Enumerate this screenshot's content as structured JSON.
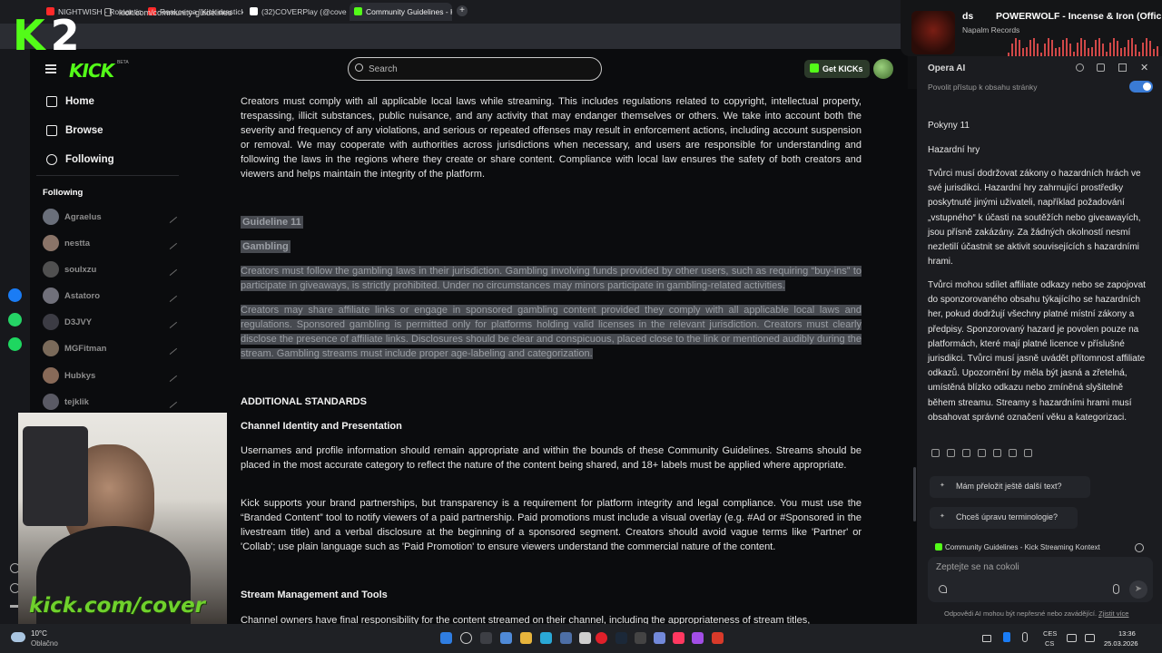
{
  "browser": {
    "tabs": [
      {
        "label": "NIGHTWISH - Romanticid",
        "favicon_color": "#ff2a2a"
      },
      {
        "label": "Reakce na \"Kick drasticky",
        "favicon_color": "#ff2a2a"
      },
      {
        "label": "(32)COVERPlay (@coverpl",
        "favicon_color": "#ffffff"
      },
      {
        "label": "Community Guidelines - K",
        "favicon_color": "#53fc18"
      }
    ],
    "new_tab": "+",
    "url": "kick.com/community-guidelines"
  },
  "kick": {
    "logo": "KICK",
    "beta": "BETA",
    "search_placeholder": "Search",
    "get_kicks": "Get KICKs",
    "nav": [
      {
        "label": "Home",
        "icon": "home-icon"
      },
      {
        "label": "Browse",
        "icon": "browse-icon"
      },
      {
        "label": "Following",
        "icon": "heart-icon"
      }
    ],
    "following_title": "Following",
    "following": [
      "Agraelus",
      "nestta",
      "soulxzu",
      "Astatoro",
      "D3JVY",
      "MGFitman",
      "Hubkys",
      "tejklik"
    ],
    "accent": "#53fc18"
  },
  "article": {
    "intro": "Creators must comply with all applicable local laws while streaming. This includes regulations related to copyright, intellectual property, trespassing, illicit substances, public nuisance, and any activity that may endanger themselves or others. We take into account both the severity and frequency of any violations, and serious or repeated offenses may result in enforcement actions, including account suspension or removal. We may cooperate with authorities across jurisdictions when necessary, and users are responsible for understanding and following the laws in the regions where they create or share content. Compliance with local law ensures the safety of both creators and viewers and helps maintain the integrity of the platform.",
    "g11_label": "Guideline 11",
    "g11_title": "Gambling",
    "g11_p1": "Creators must follow the gambling laws in their jurisdiction. Gambling involving funds provided by other users, such as requiring “buy-ins” to participate in giveaways, is strictly prohibited. Under no circumstances may minors participate in gambling-related activities.",
    "g11_p2": "Creators may share affiliate links or engage in sponsored gambling content provided they comply with all applicable local laws and regulations. Sponsored gambling is permitted only for platforms holding valid licenses in the relevant jurisdiction. Creators must clearly disclose the presence of affiliate links. Disclosures should be clear and conspicuous, placed close to the link or mentioned audibly during the stream. Gambling streams must include proper age-labeling and categorization.",
    "additional": "ADDITIONAL STANDARDS",
    "channel_title": "Channel Identity and Presentation",
    "channel_p1": "Usernames and profile information should remain appropriate and within the bounds of these Community Guidelines. Streams should be placed in the most accurate category to reflect the nature of the content being shared, and 18+ labels must be applied where appropriate.",
    "channel_p2": "Kick supports your brand partnerships, but transparency is a requirement for platform integrity and legal compliance. You must use the “Branded Content” tool to notify viewers of a paid partnership. Paid promotions must include a visual overlay (e.g. #Ad or #Sponsored in the livestream title) and a verbal disclosure at the beginning of a sponsored segment. Creators should avoid vague terms like 'Partner' or 'Collab'; use plain language such as 'Paid Promotion' to ensure viewers understand the commercial nature of the content.",
    "stream_title": "Stream Management and Tools",
    "stream_p1": "Channel owners have final responsibility for the content streamed on their channel, including the appropriateness of stream titles,"
  },
  "opera_ai": {
    "title": "Opera AI",
    "permission": "Povolit přístup k obsahu stránky",
    "permission_on": true,
    "answer_h1": "Pokyny 11",
    "answer_h2": "Hazardní hry",
    "answer_p1": "Tvůrci musí dodržovat zákony o hazardních hrách ve své jurisdikci. Hazardní hry zahrnující prostředky poskytnuté jinými uživateli, například požadování „vstupného“ k účasti na soutěžích nebo giveawayích, jsou přísně zakázány. Za žádných okolností nesmí nezletilí účastnit se aktivit souvisejících s hazardními hrami.",
    "answer_p2": "Tvůrci mohou sdílet affiliate odkazy nebo se zapojovat do sponzorovaného obsahu týkajícího se hazardních her, pokud dodržují všechny platné místní zákony a předpisy. Sponzorovaný hazard je povolen pouze na platformách, které mají platné licence v příslušné jurisdikci. Tvůrci musí jasně uvádět přítomnost affiliate odkazů. Upozornění by měla být jasná a zřetelná, umístěná blízko odkazu nebo zmíněná slyšitelně během streamu. Streamy s hazardními hrami musí obsahovat správné označení věku a kategorizaci.",
    "suggestions": [
      "Mám přeložit ještě další text?",
      "Chceš úpravu terminologie?"
    ],
    "context": "Community Guidelines - Kick Streaming Kontext",
    "ask_placeholder": "Zeptejte se na cokoli",
    "disclaimer": "Odpovědi AI mohou být nepřesné nebo zavádějící.",
    "learn_more": "Zjistit více"
  },
  "music": {
    "prefix": "ds",
    "title": "POWERWOLF - Incense & Iron (Offic",
    "label": "Napalm Records"
  },
  "overlay": {
    "brand_k": "K",
    "brand_2": "2",
    "cam_text": "kick.com/cover"
  },
  "taskbar": {
    "temp": "10°C",
    "weather": "Oblačno",
    "lang_top": "CES",
    "lang_bottom": "CS",
    "time": "13:36",
    "date": "25.03.2026"
  }
}
